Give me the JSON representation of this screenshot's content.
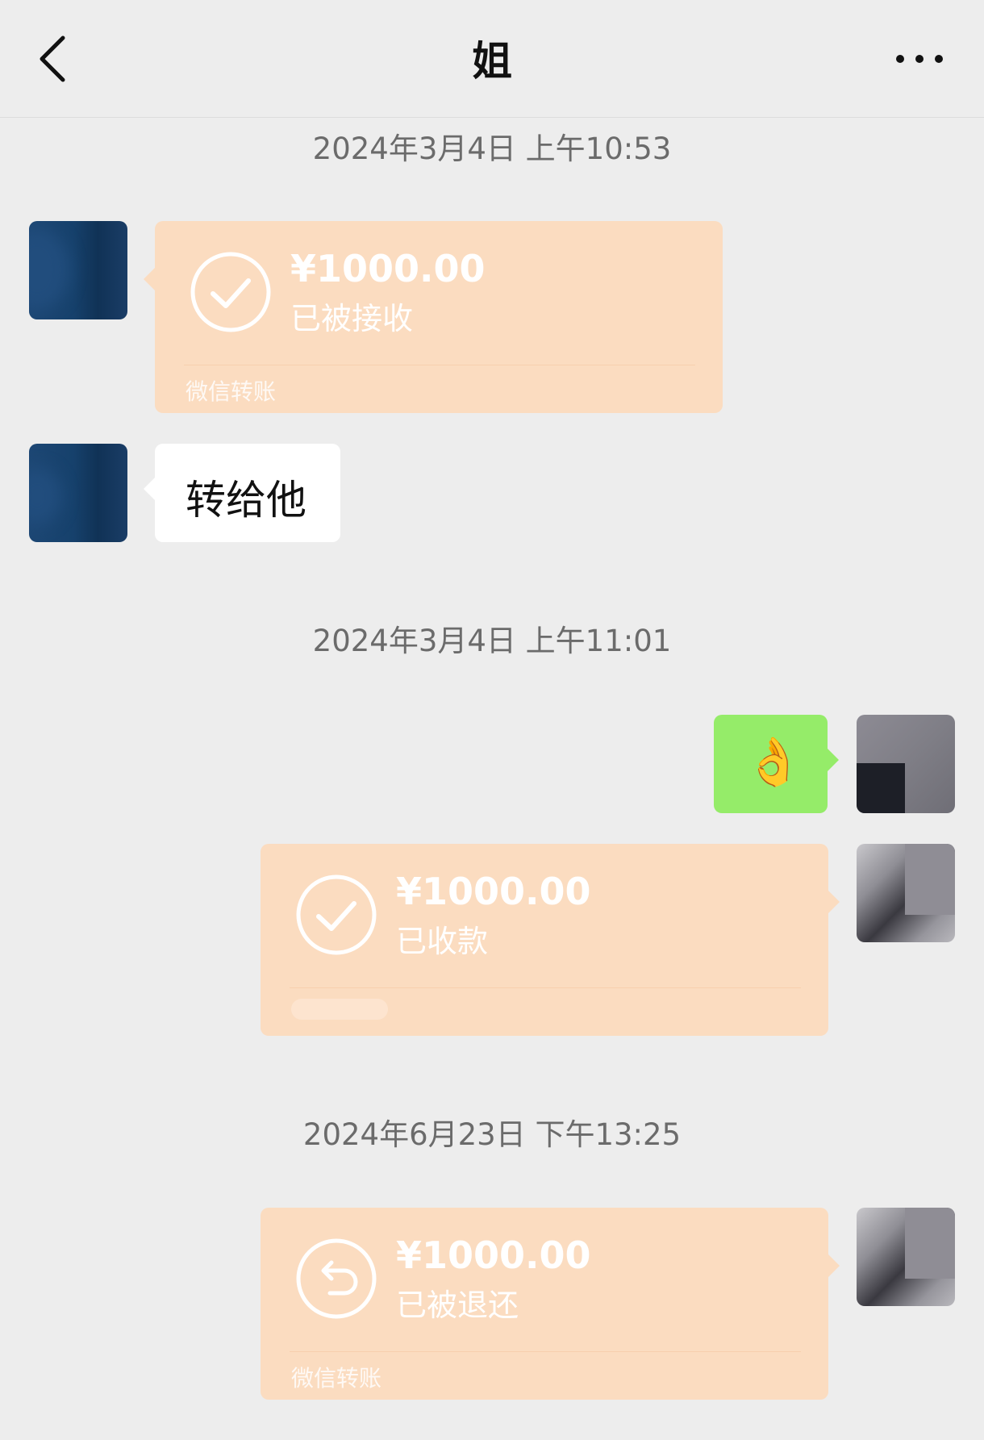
{
  "header": {
    "title": "姐",
    "back_icon": "chevron-left-icon",
    "more_icon": "ellipsis-icon"
  },
  "messages": [
    {
      "type": "timestamp",
      "text": "2024年3月4日 上午10:53"
    },
    {
      "type": "transfer",
      "side": "left",
      "amount": "¥1000.00",
      "status": "已被接收",
      "label": "微信转账",
      "icon": "check-circle-icon"
    },
    {
      "type": "text",
      "side": "left",
      "text": "转给他"
    },
    {
      "type": "timestamp",
      "text": "2024年3月4日 上午11:01"
    },
    {
      "type": "emoji",
      "side": "right",
      "emoji": "👌"
    },
    {
      "type": "transfer",
      "side": "right",
      "amount": "¥1000.00",
      "status": "已收款",
      "icon": "check-circle-icon"
    },
    {
      "type": "timestamp",
      "text": "2024年6月23日 下午13:25"
    },
    {
      "type": "transfer",
      "side": "right",
      "amount": "¥1000.00",
      "status": "已被退还",
      "label": "微信转账",
      "icon": "return-arrow-icon"
    }
  ],
  "colors": {
    "background": "#ededed",
    "transfer_bubble": "#fbdcc0",
    "sent_bubble": "#95ec69",
    "received_bubble": "#ffffff"
  }
}
